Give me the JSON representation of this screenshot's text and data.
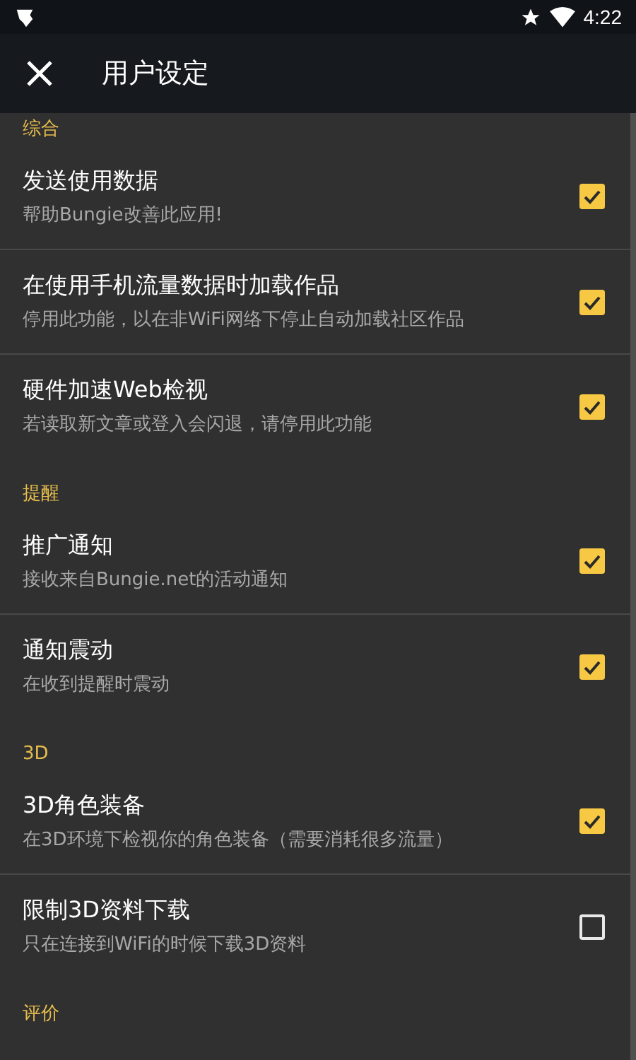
{
  "status_bar": {
    "time": "4:22"
  },
  "toolbar": {
    "title": "用户设定"
  },
  "sections": [
    {
      "title": "综合",
      "items": [
        {
          "title": "发送使用数据",
          "subtitle": "帮助Bungie改善此应用!",
          "checked": true
        },
        {
          "title": "在使用手机流量数据时加载作品",
          "subtitle": "停用此功能，以在非WiFi网络下停止自动加载社区作品",
          "checked": true
        },
        {
          "title": "硬件加速Web检视",
          "subtitle": "若读取新文章或登入会闪退，请停用此功能",
          "checked": true
        }
      ]
    },
    {
      "title": "提醒",
      "items": [
        {
          "title": "推广通知",
          "subtitle": "接收来自Bungie.net的活动通知",
          "checked": true
        },
        {
          "title": "通知震动",
          "subtitle": "在收到提醒时震动",
          "checked": true
        }
      ]
    },
    {
      "title": "3D",
      "items": [
        {
          "title": "3D角色装备",
          "subtitle": "在3D环境下检视你的角色装备（需要消耗很多流量）",
          "checked": true
        },
        {
          "title": "限制3D资料下载",
          "subtitle": "只在连接到WiFi的时候下载3D资料",
          "checked": false
        }
      ]
    },
    {
      "title": "评价"
    }
  ]
}
